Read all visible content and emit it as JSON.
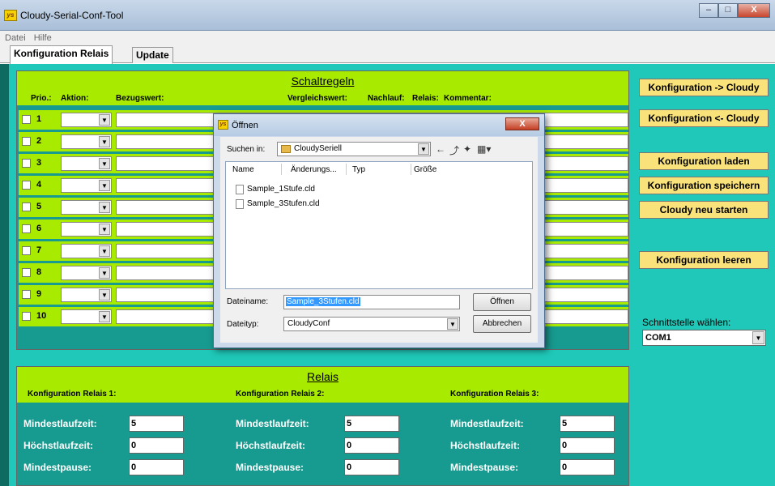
{
  "window": {
    "title": "Cloudy-Serial-Conf-Tool",
    "app_icon": "sq-logo-icon",
    "controls": [
      "–",
      "□",
      "X"
    ]
  },
  "menu": [
    "Datei",
    "Hilfe"
  ],
  "tabs": [
    "Konfiguration Relais",
    "Update"
  ],
  "schaltregeln": {
    "title": "Schaltregeln",
    "columns": [
      "Prio.:",
      "Aktion:",
      "Bezugswert:",
      "Vergleichswert:",
      "Nachlauf:",
      "Relais:",
      "Kommentar:"
    ],
    "rows": [
      "1",
      "2",
      "3",
      "4",
      "5",
      "6",
      "7",
      "8",
      "9",
      "10"
    ]
  },
  "relais": {
    "title": "Relais",
    "groups": [
      {
        "header": "Konfiguration Relais 1:",
        "fields": [
          {
            "label": "Mindestlaufzeit:",
            "value": "5"
          },
          {
            "label": "Höchstlaufzeit:",
            "value": "0"
          },
          {
            "label": "Mindestpause:",
            "value": "0"
          }
        ]
      },
      {
        "header": "Konfiguration Relais 2:",
        "fields": [
          {
            "label": "Mindestlaufzeit:",
            "value": "5"
          },
          {
            "label": "Höchstlaufzeit:",
            "value": "0"
          },
          {
            "label": "Mindestpause:",
            "value": "0"
          }
        ]
      },
      {
        "header": "Konfiguration Relais 3:",
        "fields": [
          {
            "label": "Mindestlaufzeit:",
            "value": "5"
          },
          {
            "label": "Höchstlaufzeit:",
            "value": "0"
          },
          {
            "label": "Mindestpause:",
            "value": "0"
          }
        ]
      }
    ]
  },
  "buttons": {
    "to_cloudy": "Konfiguration -> Cloudy",
    "from_cloudy": "Konfiguration <- Cloudy",
    "load": "Konfiguration laden",
    "save": "Konfiguration speichern",
    "restart": "Cloudy neu starten",
    "clear": "Konfiguration leeren"
  },
  "port": {
    "label": "Schnittstelle wählen:",
    "value": "COM1"
  },
  "dialog": {
    "title": "Öffnen",
    "lookin_label": "Suchen in:",
    "lookin_value": "CloudySeriell",
    "list_headers": [
      "Name",
      "Änderungs...",
      "Typ",
      "Größe"
    ],
    "files": [
      "Sample_1Stufe.cld",
      "Sample_3Stufen.cld"
    ],
    "filename_label": "Dateiname:",
    "filename_value": "Sample_3Stufen.cld",
    "filetype_label": "Dateityp:",
    "filetype_value": "CloudyConf",
    "open_button": "Öffnen",
    "cancel_button": "Abbrechen",
    "close": "X"
  },
  "colors": {
    "lime": "#a8ea00",
    "teal": "#179a8f",
    "cyan": "#1fc8b8",
    "button": "#f9e27a"
  }
}
